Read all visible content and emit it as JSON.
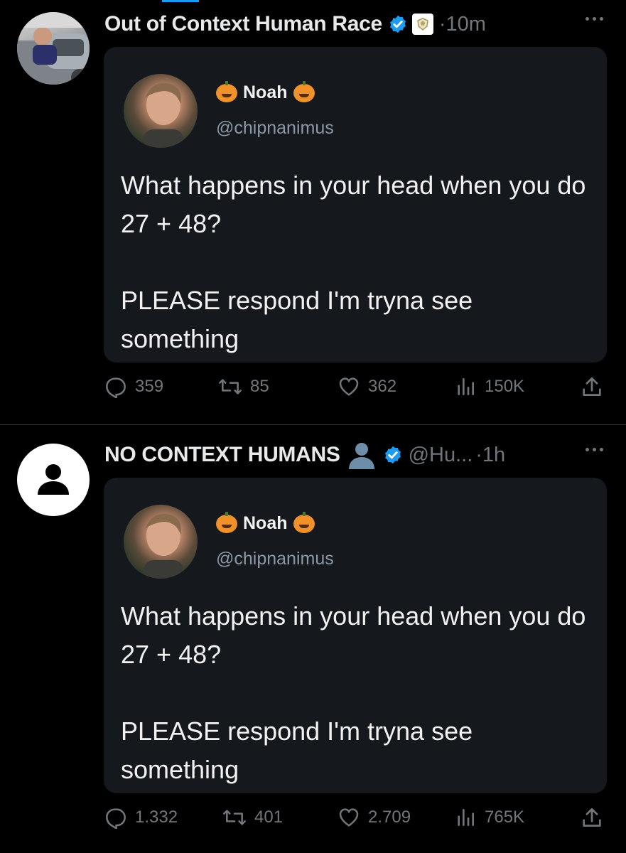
{
  "tweets": [
    {
      "author_name": "Out of Context Human Race",
      "handle": "",
      "time": "·10m",
      "quoted": {
        "name": "Noah",
        "handle": "@chipnanimus",
        "text_line1": "What happens in your head when you do 27 + 48?",
        "text_line2": "PLEASE respond I'm tryna see something"
      },
      "stats": {
        "replies": "359",
        "reposts": "85",
        "likes": "362",
        "views": "150K"
      }
    },
    {
      "author_name": "NO CONTEXT HUMANS",
      "handle": "@Hu...",
      "time": "·1h",
      "quoted": {
        "name": "Noah",
        "handle": "@chipnanimus",
        "text_line1": "What happens in your head when you do 27 + 48?",
        "text_line2": "PLEASE respond I'm tryna see something"
      },
      "stats": {
        "replies": "1.332",
        "reposts": "401",
        "likes": "2.709",
        "views": "765K"
      }
    }
  ],
  "colors": {
    "accent": "#1d9bf0",
    "muted": "#71767b",
    "card": "#15181c",
    "pumpkin": "#f0912a"
  },
  "icons": [
    "verified-badge-icon",
    "affiliate-badge-icon",
    "bust-emoji-icon",
    "pumpkin-emoji-icon",
    "reply-icon",
    "repost-icon",
    "like-icon",
    "views-icon",
    "share-icon",
    "more-icon",
    "default-avatar-icon"
  ]
}
